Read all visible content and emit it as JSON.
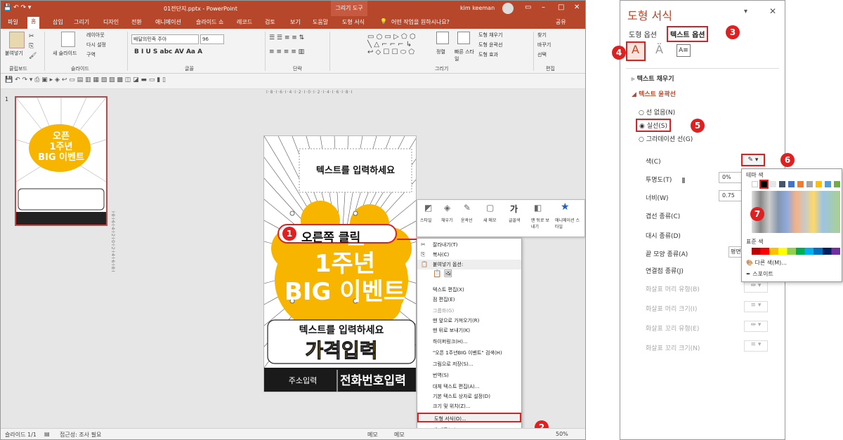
{
  "titlebar": {
    "filename": "01전단지.pptx - PowerPoint",
    "tool_tab": "그리기 도구",
    "user": "kim keeman"
  },
  "tabs": [
    "파일",
    "홈",
    "삽입",
    "그리기",
    "디자인",
    "전환",
    "애니메이션",
    "슬라이드 쇼",
    "레코드",
    "검토",
    "보기",
    "도움말",
    "도형 서식"
  ],
  "tell_me": "어떤 작업을 원하시나요?",
  "share": "공유",
  "ribbon": {
    "paste": "붙여넣기",
    "new_slide": "새 슬라이드",
    "layout": "레이아웃",
    "reset": "다시 설정",
    "section": "구역",
    "font_name": "배달의민족 주아",
    "font_size": "96",
    "arrange": "정렬",
    "quick_styles": "빠른 스타일",
    "shape_fill": "도형 채우기",
    "shape_outline": "도형 윤곽선",
    "shape_effects": "도형 효과",
    "find": "찾기",
    "replace": "바꾸기",
    "select": "선택",
    "groups": [
      "클립보드",
      "슬라이드",
      "글꼴",
      "단락",
      "그리기",
      "편집"
    ]
  },
  "slide_number": "1",
  "thumb_text": [
    "오픈",
    "1주년",
    "BIG 이벤트"
  ],
  "slide": {
    "text1": "텍스트를 입력하세요",
    "big1": "오픈",
    "big2": "1주년",
    "big3": "BIG 이벤트",
    "text2": "텍스트를 입력하세요",
    "price": "가격입력",
    "address": "주소입력",
    "phone": "전화번호입력"
  },
  "mini_toolbar": [
    "스타일",
    "채우기",
    "윤곽선",
    "새 메모",
    "글꼴색",
    "맨 뒤로 보내기",
    "애니메이션 스타일"
  ],
  "context_menu": [
    "잘라내기(T)",
    "복사(C)",
    "붙여넣기 옵션:",
    "",
    "텍스트 편집(X)",
    "점 편집(E)",
    "그룹화(G)",
    "맨 앞으로 가져오기(R)",
    "맨 뒤로 보내기(K)",
    "하이퍼링크(H)...",
    "\"오픈 1주년BIG 이벤트\" 검색(H)",
    "그림으로 저장(S)...",
    "번역(S)",
    "대체 텍스트 편집(A)...",
    "기본 텍스트 상자로 설정(D)",
    "크기 및 위치(Z)...",
    "도형 서식(O)...",
    "새 메모(M)"
  ],
  "callouts": {
    "c1": "1",
    "c1_label": "오른쪽 클릭",
    "c2": "2",
    "c3": "3",
    "c4": "4",
    "c5": "5",
    "c6": "6",
    "c7": "7"
  },
  "status": {
    "slide": "슬라이드 1/1",
    "accessibility": "접근성: 조사 필요",
    "notes": "메모",
    "comments": "메모",
    "zoom": "50%"
  },
  "format_panel": {
    "title": "도형 서식",
    "tab_shape": "도형 옵션",
    "tab_text": "텍스트 옵션",
    "sec_fill": "텍스트 채우기",
    "sec_outline": "텍스트 윤곽선",
    "opt_none": "선 없음(N)",
    "opt_solid": "실선(S)",
    "opt_gradient": "그라데이션 선(G)",
    "color": "색(C)",
    "transparency": "투명도(T)",
    "transparency_val": "0%",
    "width": "너비(W)",
    "width_val": "0.75",
    "compound": "겹선 종류(C)",
    "dash": "대시 종류(D)",
    "cap": "끝 모양 종류(A)",
    "cap_val": "평면",
    "join": "연결점 종류(J)",
    "arrow_begin_type": "화살표 머리 유형(B)",
    "arrow_begin_size": "화살표 머리 크기(I)",
    "arrow_end_type": "화살표 꼬리 유형(E)",
    "arrow_end_size": "화살표 꼬리 크기(N)"
  },
  "color_popup": {
    "theme": "테마 색",
    "standard": "표준 색",
    "more": "다른 색(M)...",
    "eyedropper": "스포이트"
  },
  "colors": {
    "accent": "#b7472a",
    "callout": "#e02020",
    "yellow": "#f8b500"
  }
}
